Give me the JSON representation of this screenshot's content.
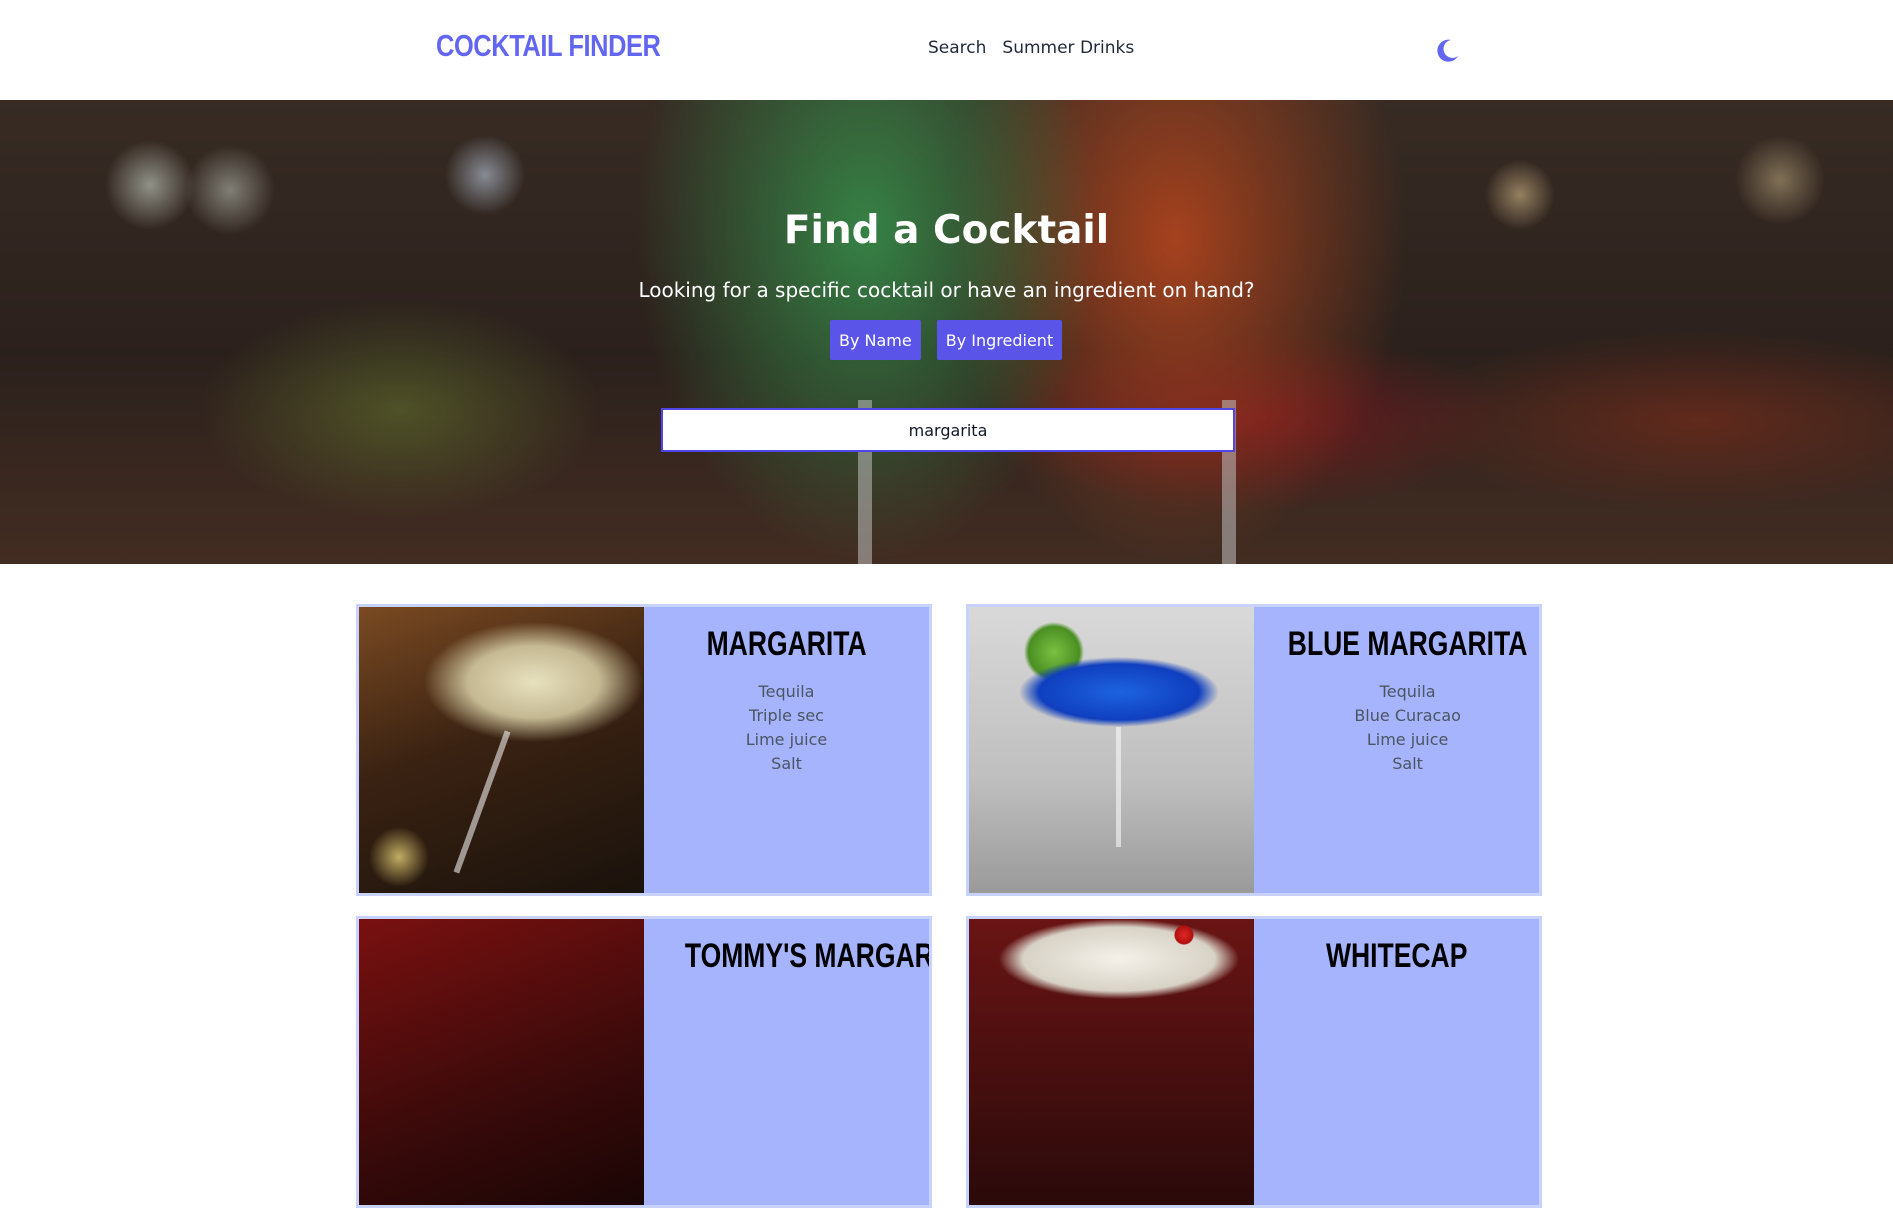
{
  "navbar": {
    "logo": "COCKTAIL FINDER",
    "links": [
      "Search",
      "Summer Drinks"
    ],
    "theme_icon": "moon-icon",
    "accent_color": "#6366f1"
  },
  "hero": {
    "title": "Find a Cocktail",
    "subtitle": "Looking for a specific cocktail or have an ingredient on hand?",
    "mode_buttons": [
      "By Name",
      "By Ingredient"
    ],
    "search_value": "margarita",
    "button_color": "#5a55e8"
  },
  "results": [
    {
      "name": "Margarita",
      "ingredients": [
        "Tequila",
        "Triple sec",
        "Lime juice",
        "Salt"
      ]
    },
    {
      "name": "Blue Margarita",
      "ingredients": [
        "Tequila",
        "Blue Curacao",
        "Lime juice",
        "Salt"
      ]
    },
    {
      "name": "Tommy's Margarita",
      "ingredients": []
    },
    {
      "name": "Whitecap",
      "ingredients": []
    }
  ],
  "card_color": "#a5b4fc"
}
